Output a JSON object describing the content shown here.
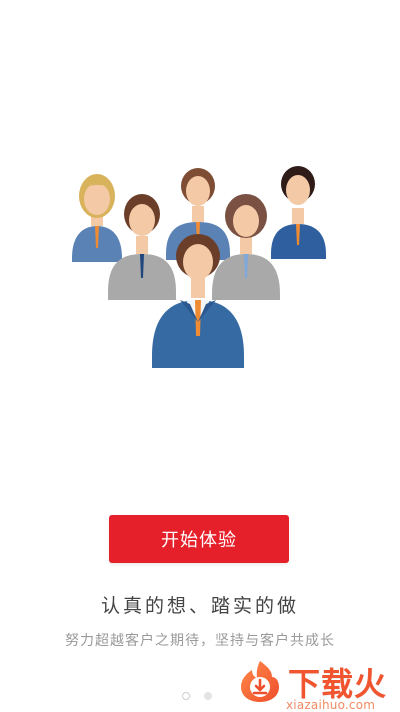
{
  "button": {
    "label": "开始体验"
  },
  "slogan": "认真的想、踏实的做",
  "subtitle": "努力超越客户之期待，坚持与客户共成长",
  "pager": {
    "count": 2,
    "active_index": 1
  },
  "watermark": {
    "title": "下载火",
    "url": "xiazaihuo.com",
    "accent_color": "#f0552f"
  },
  "colors": {
    "button": "#e5202b",
    "text_primary": "#444444",
    "text_secondary": "#9a9a9a",
    "background": "#ffffff"
  },
  "illustration": {
    "icon": "team-illustration"
  }
}
